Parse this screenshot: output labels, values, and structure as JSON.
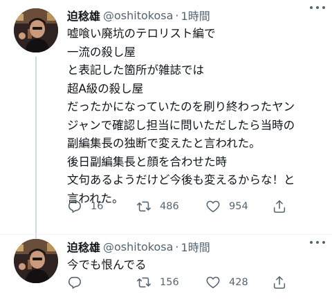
{
  "tweets": [
    {
      "author": {
        "name": "迫稔雄",
        "handle": "@oshitokosa",
        "separator": "·",
        "time": "1時間"
      },
      "lines": [
        "嘘喰い廃坑のテロリスト編で",
        "一流の殺し屋",
        "と表記した箇所が雑誌では",
        "超A級の殺し屋",
        "だったかになっていたのを刷り終わったヤン",
        "ジャンで確認し担当に問いただしたら当時の",
        "副編集長の独断で変えたと言われた。",
        "後日副編集長と顔を合わせた時",
        "文句あるようだけど今後も変えるからな！と",
        "言われた。"
      ],
      "stats": {
        "replies": "16",
        "retweets": "486",
        "likes": "954"
      }
    },
    {
      "author": {
        "name": "迫稔雄",
        "handle": "@oshitokosa",
        "separator": "·",
        "time": "1時間"
      },
      "lines": [
        "今でも恨んでる"
      ],
      "stats": {
        "replies": "",
        "retweets": "156",
        "likes": "428"
      }
    }
  ],
  "icons": {
    "more": "more-horizontal-icon",
    "reply": "speech-bubble-icon",
    "retweet": "retweet-arrows-icon",
    "like": "heart-outline-icon",
    "share": "share-upload-icon"
  },
  "colors": {
    "text": "#0f1419",
    "secondary": "#536471",
    "thread_line": "#cfd9de"
  }
}
